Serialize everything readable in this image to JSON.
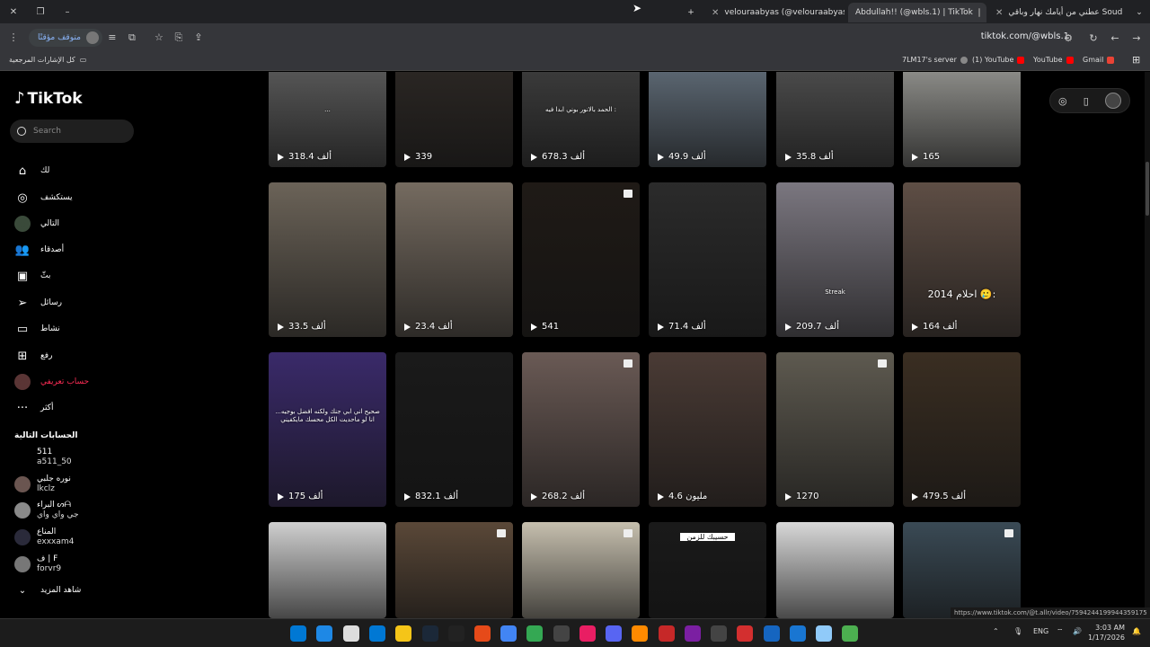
{
  "browser": {
    "tabs": [
      {
        "title": "velouraabyas (@velouraabyas)",
        "active": false
      },
      {
        "title": "Abdullah!! (@wbls.1) | TikTok",
        "active": true
      },
      {
        "title": "عطني من أيامك نهار وباقي ‎Soud",
        "active": false
      }
    ],
    "new_tab": "+",
    "url": "tiktok.com/@wbls.1",
    "paused_label": "متوقف مؤقتًا",
    "bookmarks_all": "كل الإشارات المرجعية",
    "bookmarks": [
      {
        "label": "7LM17's server",
        "color": "#5865f2"
      },
      {
        "label": "(1) YouTube",
        "color": "#ff0000"
      },
      {
        "label": "YouTube",
        "color": "#ff0000"
      },
      {
        "label": "Gmail",
        "color": "#ea4335"
      }
    ]
  },
  "app": {
    "logo": "TikTok",
    "search_placeholder": "Search",
    "nav": [
      {
        "label": "لك",
        "icon": "home-icon",
        "glyph": "⌂"
      },
      {
        "label": "يستكشف",
        "icon": "explore-icon",
        "glyph": "◎"
      },
      {
        "label": "التالي",
        "icon": "following-avatar-icon",
        "glyph": "●"
      },
      {
        "label": "أصدقاء",
        "icon": "friends-icon",
        "glyph": "👥"
      },
      {
        "label": "بثّ",
        "icon": "live-icon",
        "glyph": "▣"
      },
      {
        "label": "رسائل",
        "icon": "messages-icon",
        "glyph": "➢"
      },
      {
        "label": "نشاط",
        "icon": "activity-icon",
        "glyph": "▭"
      },
      {
        "label": "رفع",
        "icon": "upload-icon",
        "glyph": "⊞"
      },
      {
        "label": "حساب تعريفي",
        "icon": "profile-icon",
        "glyph": "●"
      },
      {
        "label": "أكثر",
        "icon": "more-icon",
        "glyph": "···"
      }
    ],
    "following_title": "الحسابات التالية",
    "following": [
      {
        "name": "511",
        "handle": "a511_50"
      },
      {
        "name": "نوره جلبي",
        "handle": "lkclz"
      },
      {
        "name": "البراء ᔕᗩ",
        "handle": "جي واي واي"
      },
      {
        "name": "المناع",
        "handle": "exxxam4"
      },
      {
        "name": "ف | F",
        "handle": "forvr9"
      }
    ],
    "see_more": "شاهد المزيد"
  },
  "videos": [
    {
      "views": "318.4 ألف",
      "bg": "#555",
      "caption": "..."
    },
    {
      "views": "339",
      "bg": "#2a2623",
      "caption": ""
    },
    {
      "views": "678.3 ألف",
      "bg": "#3a3a3a",
      "caption": "الحمد بالانور بوني ابدا فيه :"
    },
    {
      "views": "49.9 ألف",
      "bg": "#5a6570",
      "caption": ""
    },
    {
      "views": "35.8 ألف",
      "bg": "#4a4a4a",
      "caption": ""
    },
    {
      "views": "165",
      "bg": "#8a8a86",
      "caption": ""
    },
    {
      "views": "33.5 ألف",
      "bg": "#6b6358",
      "caption": ""
    },
    {
      "views": "23.4 ألف",
      "bg": "#756b60",
      "caption": ""
    },
    {
      "views": "541",
      "bg": "#1f1a16",
      "caption": ""
    },
    {
      "views": "71.4 ألف",
      "bg": "#2b2b2b",
      "caption": ""
    },
    {
      "views": "209.7 ألف",
      "bg": "#7b7780",
      "caption": "Streak"
    },
    {
      "views": "164 ألف",
      "bg": "#5e4e45",
      "caption": "احلام 2014 🥲:"
    },
    {
      "views": "175 ألف",
      "bg": "#3a2a6a",
      "caption": "صحيح اني ابي جنك ولكنه افضل بوجيه... انا لو ماحديت الكل محسك مايكفيني"
    },
    {
      "views": "832.1 ألف",
      "bg": "#1a1a1a",
      "caption": ""
    },
    {
      "views": "268.2 ألف",
      "bg": "#6a5a55",
      "caption": ""
    },
    {
      "views": "4.6 مليون",
      "bg": "#4a3b35",
      "caption": ""
    },
    {
      "views": "1270",
      "bg": "#5e5a50",
      "caption": ""
    },
    {
      "views": "479.5 ألف",
      "bg": "#3a2e22",
      "caption": ""
    },
    {
      "views": "",
      "bg": "#cfcfcf",
      "caption": ""
    },
    {
      "views": "",
      "bg": "#5a4838",
      "caption": ""
    },
    {
      "views": "",
      "bg": "#c6bfae",
      "caption": ""
    },
    {
      "views": "",
      "bg": "#1a1a1a",
      "caption": "حسيبك للزمن"
    },
    {
      "views": "",
      "bg": "#d8d8d8",
      "caption": ""
    },
    {
      "views": "",
      "bg": "#3a4a55",
      "caption": ""
    }
  ],
  "status_url": "https://www.tiktok.com/@t.allr/video/7594244199944359175",
  "taskbar": {
    "lang": "ENG",
    "time": "3:03 AM",
    "date": "1/17/2026"
  }
}
